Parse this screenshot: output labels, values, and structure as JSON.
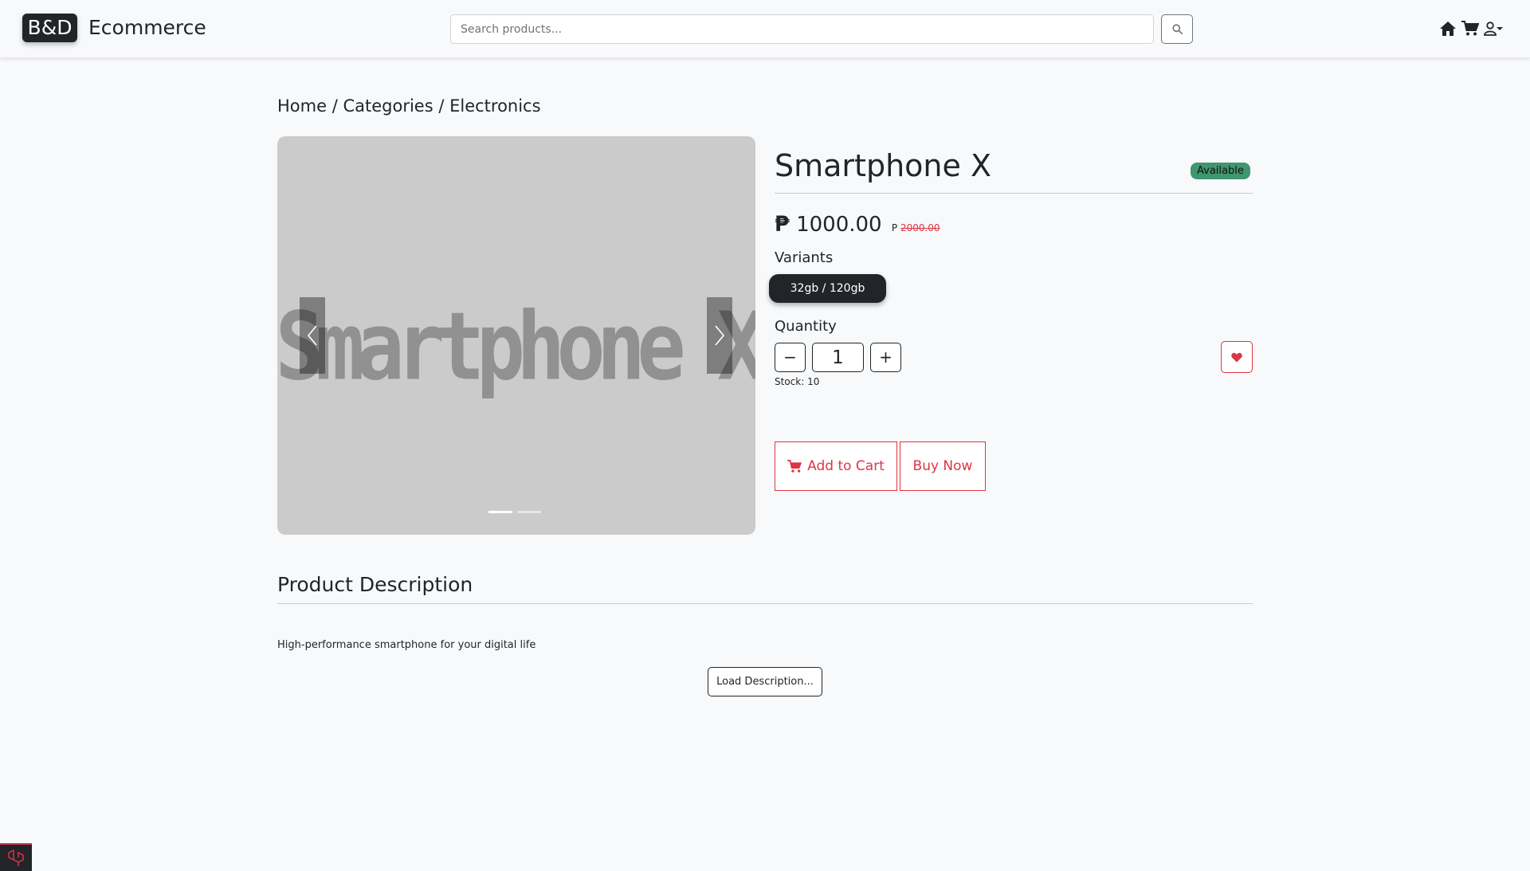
{
  "header": {
    "logo": "B&D",
    "brand_name": "Ecommerce",
    "search_placeholder": "Search products..."
  },
  "breadcrumb": [
    "Home",
    "Categories",
    "Electronics"
  ],
  "breadcrumb_sep": " / ",
  "product": {
    "image_text": "Smartphone X",
    "title": "Smartphone X",
    "status": "Available",
    "currency": "₱",
    "price": "1000.00",
    "old_currency": "P",
    "old_price": "2000.00",
    "variants_label": "Variants",
    "variants": [
      "32gb / 120gb"
    ],
    "quantity_label": "Quantity",
    "quantity": "1",
    "minus": "−",
    "plus": "+",
    "stock": "Stock: 10",
    "add_to_cart": "Add to Cart",
    "buy_now": "Buy Now"
  },
  "description": {
    "title": "Product Description",
    "text": "High-performance smartphone for your digital life",
    "load_button": "Load Description..."
  },
  "colors": {
    "accent": "#dc3545",
    "dark": "#212529",
    "success": "#3f9670"
  }
}
